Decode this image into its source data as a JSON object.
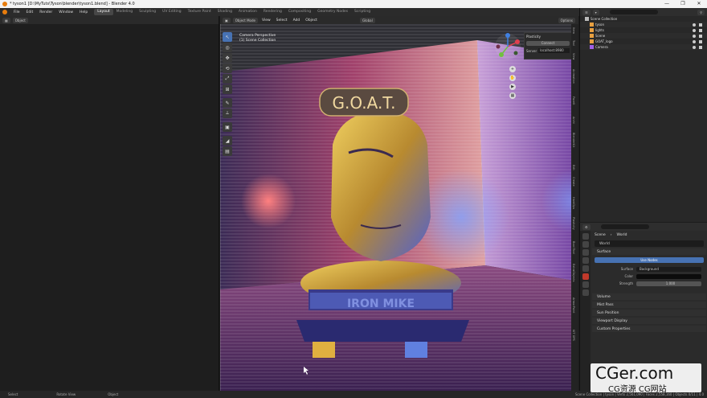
{
  "window": {
    "title": "* tyson1 [D:\\MyTuts\\Tyson\\blender\\tyson1.blend] - Blender 4.0",
    "controls": [
      "—",
      "❐",
      "✕"
    ]
  },
  "menu": {
    "items": [
      "File",
      "Edit",
      "Render",
      "Window",
      "Help"
    ],
    "workspaces": [
      "Layout",
      "Modeling",
      "Sculpting",
      "UV Editing",
      "Texture Paint",
      "Shading",
      "Animation",
      "Rendering",
      "Compositing",
      "Geometry Nodes",
      "Scripting"
    ],
    "active_workspace": "Layout",
    "right": {
      "scene_label": "Scene",
      "viewlayer_label": "ViewLayer"
    }
  },
  "left_editor": {
    "mode": "Object"
  },
  "viewport": {
    "header": {
      "mode": "Object Mode",
      "menus": [
        "View",
        "Select",
        "Add",
        "Object"
      ],
      "transform": "Global",
      "options": "Options"
    },
    "overlay": {
      "line1": "Camera Perspective",
      "line2": "(1) Scene Collection"
    },
    "toolbar": [
      "↖",
      "◎",
      "✥",
      "⟲",
      "⤢",
      "⊞",
      "✎",
      "⟂",
      "▣",
      "◢",
      "▤"
    ],
    "plasticity": {
      "title": "Plasticity",
      "button": "Connect",
      "server_label": "Server",
      "server_value": "localhost:8980"
    },
    "sign_top": "G.O.A.T.",
    "sign_base": "IRON MIKE",
    "side_tabs": [
      "Item",
      "Tool",
      "View",
      "Animation",
      "FaceIt",
      "Archi",
      "BlenderKit",
      "Edit",
      "Create",
      "HardOps",
      "Plasticity",
      "Bool Tool",
      "ExtraObjects",
      "ArmorPaint",
      "KIT OPS"
    ]
  },
  "outliner": {
    "title": "Scene Collection",
    "rows": [
      {
        "label": "Scene Collection",
        "color": "#bbbbbb"
      },
      {
        "label": "tyson",
        "color": "#e8a040"
      },
      {
        "label": "lights",
        "color": "#e8a040"
      },
      {
        "label": "Scene",
        "color": "#e8a040"
      },
      {
        "label": "GOAT_logo",
        "color": "#e8a040"
      },
      {
        "label": "Camera",
        "color": "#a05fe8"
      }
    ]
  },
  "properties": {
    "crumb_scene": "Scene",
    "crumb_world": "World",
    "world_name": "World",
    "surface_header": "Surface",
    "use_nodes": "Use Nodes",
    "surface_label": "Surface",
    "surface_value": "Background",
    "color_label": "Color",
    "strength_label": "Strength",
    "strength_value": "1.000",
    "panels": [
      "Volume",
      "Mist Pass",
      "Sun Position",
      "Viewport Display",
      "Custom Properties"
    ]
  },
  "status": {
    "left1": "Select",
    "left2": "Rotate View",
    "left3": "Object",
    "right": "Scene Collection | tyson | Verts 2,561,090 | Faces 2,558,160 | Objects 0/11 | 4.0"
  },
  "watermark": {
    "big": "CGer.com",
    "sub": "CG资源 CG网站"
  },
  "colors": {
    "accent": "#4772b3",
    "orange": "#e87d0d",
    "background": "#1d1d1d"
  }
}
